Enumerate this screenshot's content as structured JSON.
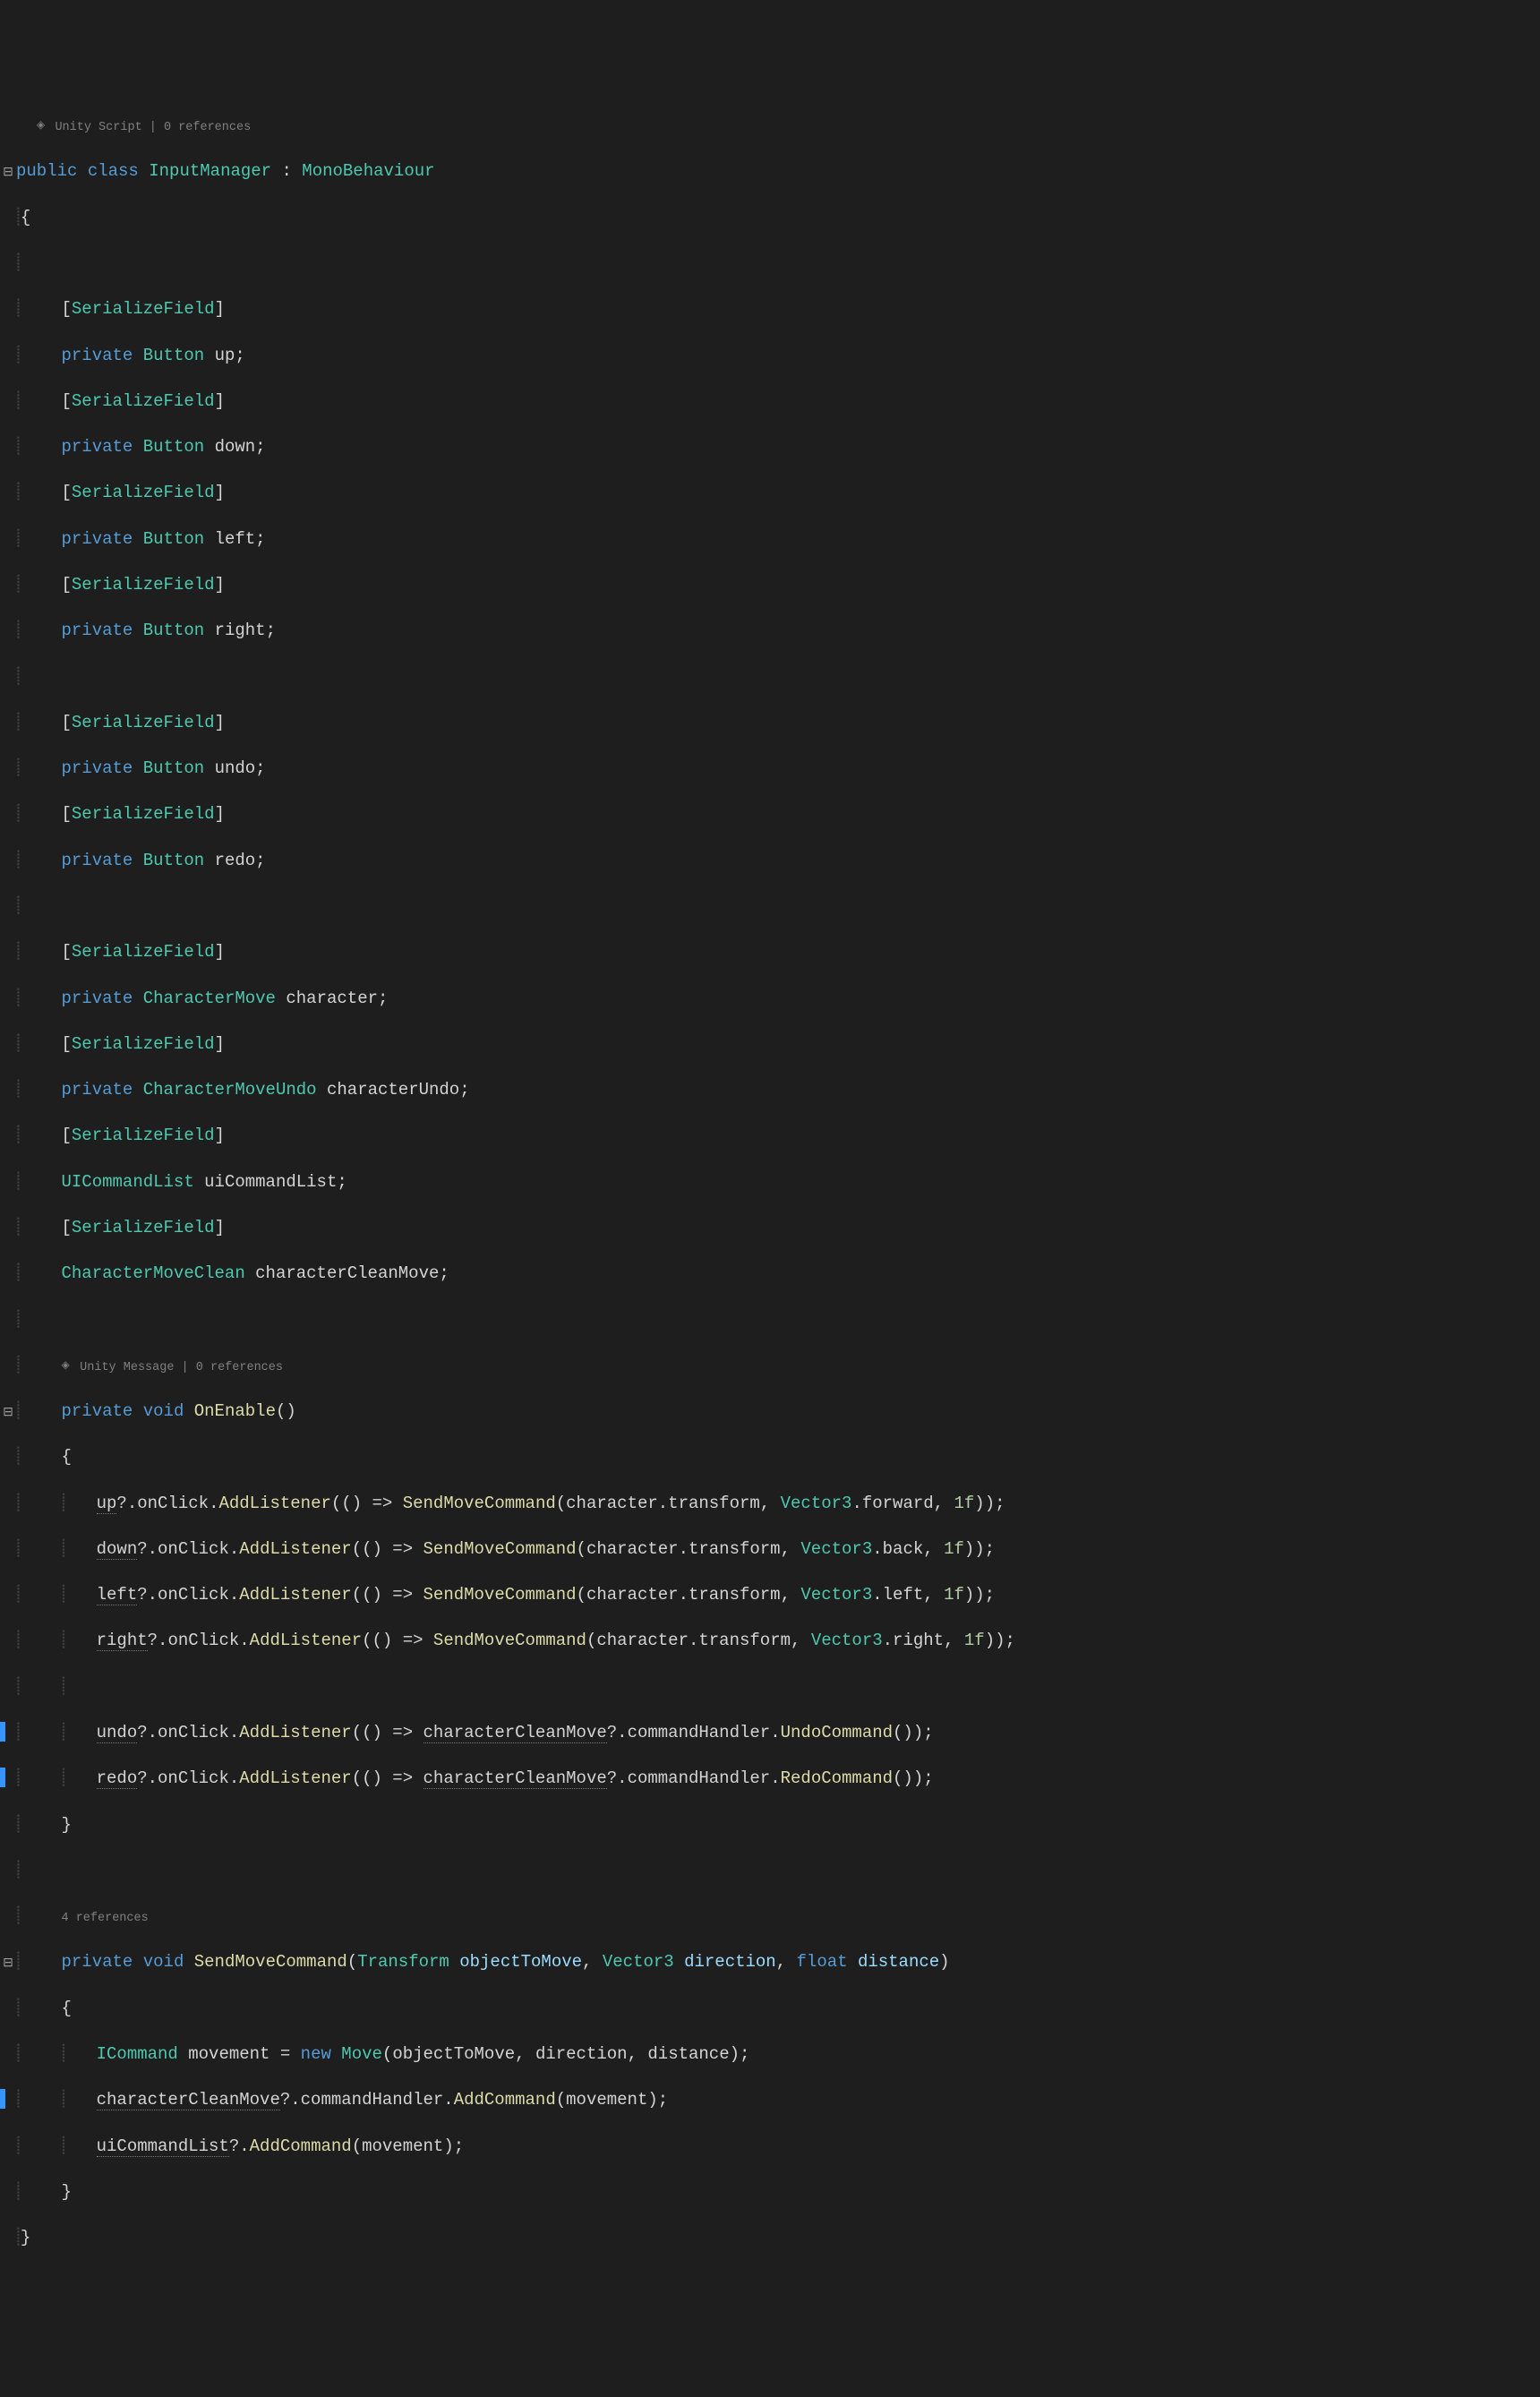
{
  "codelens": {
    "class": "Unity Script | 0 references",
    "onenable": "Unity Message | 0 references",
    "sendmove": "4 references"
  },
  "code": {
    "l1": {
      "kw1": "public",
      "kw2": "class",
      "type": "InputManager",
      "colon": ":",
      "base": "MonoBehaviour"
    },
    "l2": {
      "brace": "{"
    },
    "attr": "SerializeField",
    "priv": "private",
    "btn": "Button",
    "f_up": "up",
    "f_down": "down",
    "f_left": "left",
    "f_right": "right",
    "f_undo": "undo",
    "f_redo": "redo",
    "cm": "CharacterMove",
    "f_character": "character",
    "cmu": "CharacterMoveUndo",
    "f_charundo": "characterUndo",
    "uicl": "UICommandList",
    "f_uicl": "uiCommandList",
    "cmc": "CharacterMoveClean",
    "f_charclean": "characterCleanMove",
    "void": "void",
    "onenable": "OnEnable",
    "sendmove": "SendMoveCommand",
    "transform": "Transform",
    "p_obj": "objectToMove",
    "vec3": "Vector3",
    "p_dir": "direction",
    "float": "float",
    "p_dist": "distance",
    "onclick": "onClick",
    "addlistener": "AddListener",
    "chartrans": "character.transform",
    "forward": "forward",
    "back": "back",
    "leftv": "left",
    "rightv": "right",
    "onef": "1f",
    "cmdhandler": "commandHandler",
    "undoCmd": "UndoCommand",
    "redoCmd": "RedoCommand",
    "icommand": "ICommand",
    "movement": "movement",
    "new": "new",
    "move": "Move",
    "addcmd": "AddCommand"
  }
}
